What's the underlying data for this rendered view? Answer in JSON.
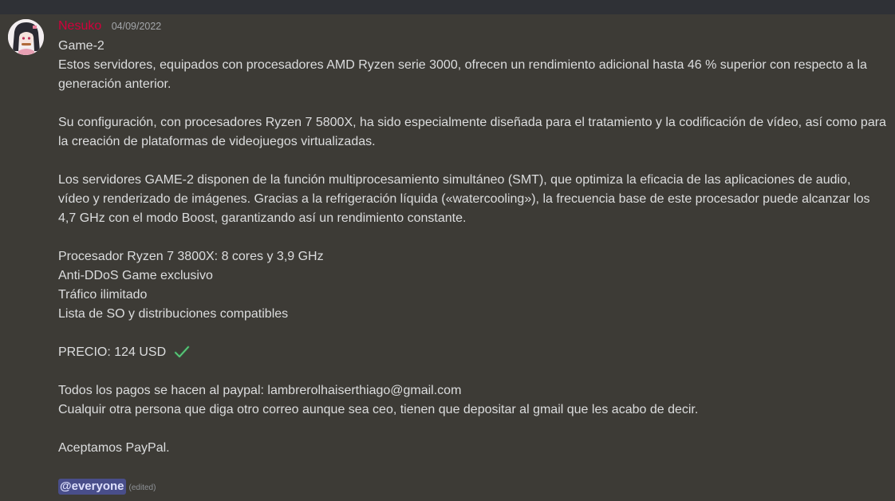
{
  "message": {
    "username": "Nesuko",
    "timestamp": "04/09/2022",
    "lines": {
      "l1": "Game-2",
      "l2": "Estos servidores, equipados con procesadores AMD Ryzen serie 3000, ofrecen un rendimiento adicional hasta 46 % superior con respecto a la",
      "l3": "generación anterior.",
      "l4": "Su configuración, con procesadores Ryzen 7 5800X, ha sido especialmente diseñada para el tratamiento y la codificación de vídeo, así como para",
      "l5": "la creación de plataformas de videojuegos virtualizadas.",
      "l6": "Los servidores GAME-2 disponen de la función multiprocesamiento simultáneo (SMT), que optimiza la eficacia de las aplicaciones de audio,",
      "l7": "vídeo y renderizado de imágenes. Gracias a la refrigeración líquida («watercooling»), la frecuencia base de este procesador puede alcanzar los",
      "l8": "4,7 GHz con el modo Boost, garantizando así un rendimiento constante.",
      "l9": "Procesador Ryzen 7 3800X: 8 cores y 3,9 GHz",
      "l10": "Anti-DDoS Game exclusivo",
      "l11": "Tráfico ilimitado",
      "l12": "Lista de SO y distribuciones compatibles",
      "l13": "PRECIO: 124 USD",
      "l14": "Todos los pagos se hacen al paypal: lambrerolhaiserthiago@gmail.com",
      "l15": "Cualquir otra persona que diga otro correo aunque sea ceo, tienen que depositar al gmail que les acabo de decir.",
      "l16": "Aceptamos PayPal."
    },
    "mention": "@everyone",
    "edited": "(edited)",
    "check_icon": "check-mark-icon"
  },
  "colors": {
    "username": "#d1003b",
    "text": "#dcddde",
    "background": "#3d3b36",
    "mention_bg": "#5865f2",
    "check": "#3ba55c"
  }
}
